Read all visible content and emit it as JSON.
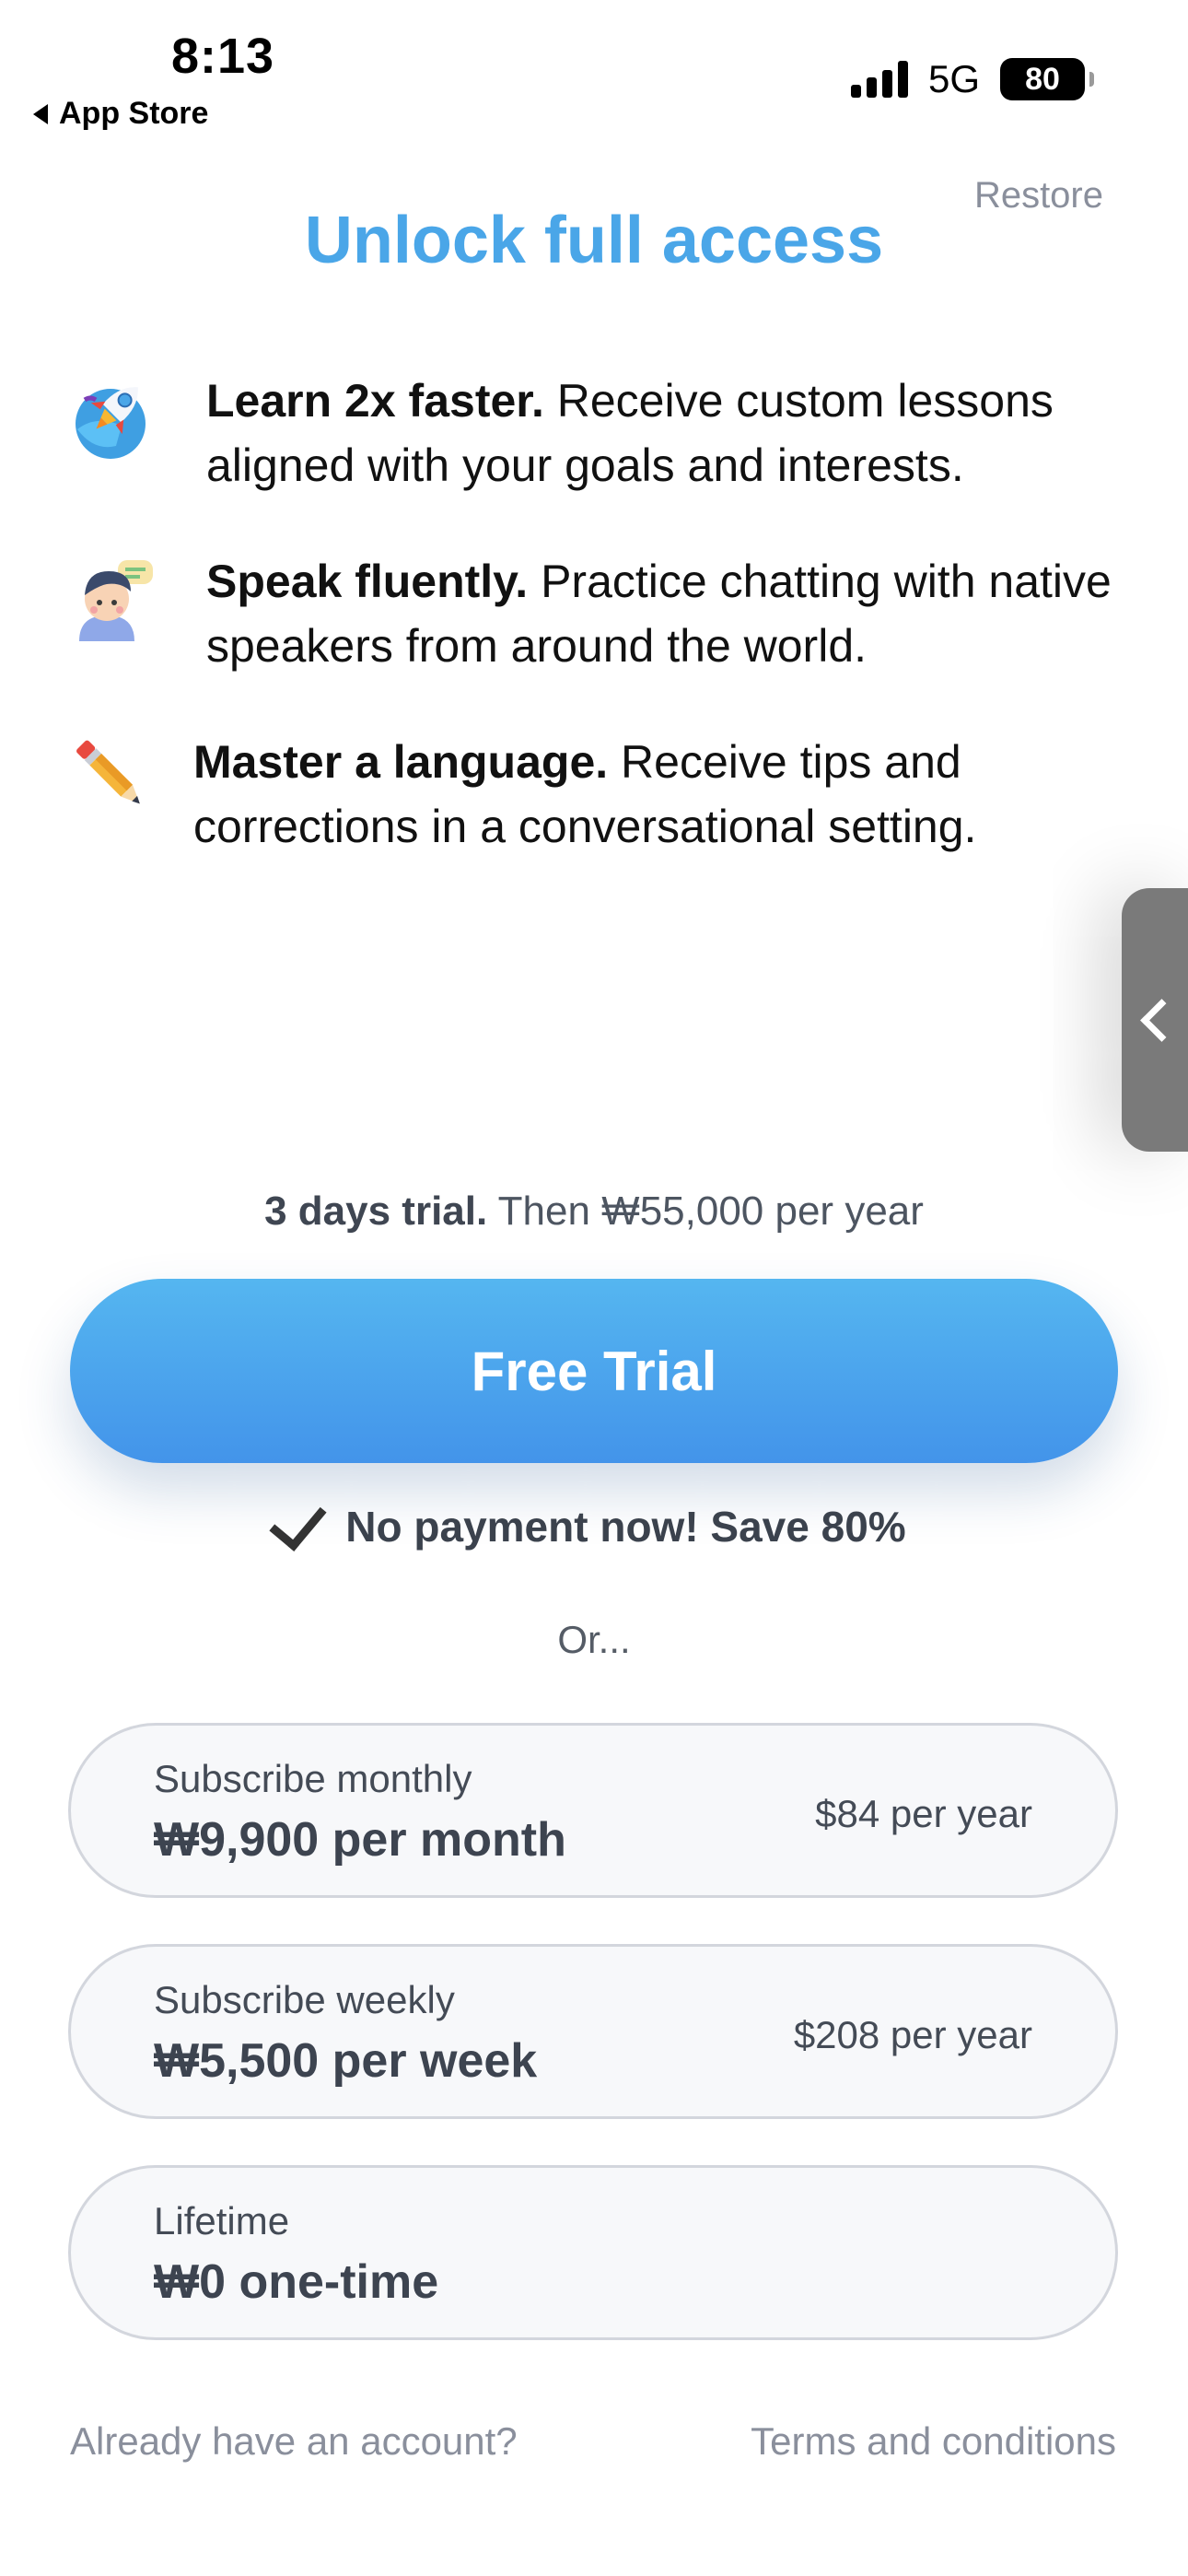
{
  "status_bar": {
    "time": "8:13",
    "back_label": "App Store",
    "network": "5G",
    "battery": "80"
  },
  "header": {
    "restore_label": "Restore",
    "title": "Unlock full access"
  },
  "features": [
    {
      "icon": "rocket-icon",
      "bold": "Learn 2x faster.",
      "text": " Receive custom lessons aligned with your goals and interests."
    },
    {
      "icon": "person-chat-icon",
      "bold": "Speak fluently.",
      "text": " Practice chatting with native speakers from around the world."
    },
    {
      "icon": "pencil-icon",
      "bold": "Master a language.",
      "text": " Receive tips and corrections in a conversational setting."
    }
  ],
  "trial": {
    "bold": "3 days trial.",
    "text": " Then ₩55,000 per year",
    "button_label": "Free Trial",
    "no_payment": "No payment now! Save 80%",
    "or_label": "Or..."
  },
  "plans": [
    {
      "name": "Subscribe monthly",
      "price": "₩9,900 per month",
      "per_year": "$84 per year"
    },
    {
      "name": "Subscribe weekly",
      "price": "₩5,500 per week",
      "per_year": "$208 per year"
    },
    {
      "name": "Lifetime",
      "price": "₩0 one-time",
      "per_year": ""
    }
  ],
  "footer": {
    "account_link": "Already have an account?",
    "terms_link": "Terms and conditions"
  },
  "colors": {
    "accent": "#4aa6e8",
    "button_top": "#55b6f0",
    "button_bottom": "#4394ea",
    "muted_text": "#8a8f9c"
  }
}
